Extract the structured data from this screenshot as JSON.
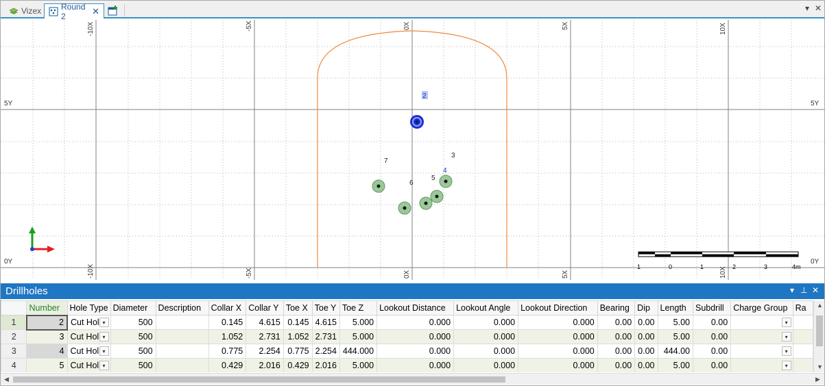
{
  "tabs": [
    {
      "label": "Vizex",
      "active": false
    },
    {
      "label": "Round 2",
      "active": true
    }
  ],
  "window_controls": {
    "dropdown": "▾",
    "close": "✕"
  },
  "viewport": {
    "x_labels": [
      "-10X",
      "-5X",
      "0X",
      "5X",
      "10X"
    ],
    "y_labels": [
      "5Y",
      "0Y"
    ],
    "hole_labels": [
      "2",
      "3",
      "4",
      "5",
      "6",
      "7"
    ],
    "scale_labels": [
      "1",
      "0",
      "1",
      "2",
      "3",
      "4m"
    ],
    "colors": {
      "profile": "#f08a3a",
      "selected_hole": "#1a2fd0",
      "hole_fill": "#9cc79a",
      "grid_major": "#777777",
      "grid_minor": "#aaaaaa"
    }
  },
  "panel": {
    "title": "Drillholes",
    "controls": {
      "dropdown": "▾",
      "pin": "⊥",
      "close": "✕"
    }
  },
  "table": {
    "columns": [
      "Number",
      "Hole Type",
      "Diameter",
      "Description",
      "Collar X",
      "Collar Y",
      "Toe X",
      "Toe Y",
      "Toe Z",
      "Lookout Distance",
      "Lookout Angle",
      "Lookout Direction",
      "Bearing",
      "Dip",
      "Length",
      "Subdrill",
      "Charge Group",
      "Ra"
    ],
    "rows": [
      {
        "row": "1",
        "cells": [
          "2",
          "Cut Hol",
          "500",
          "",
          "0.145",
          "4.615",
          "0.145",
          "4.615",
          "5.000",
          "0.000",
          "0.000",
          "0.000",
          "0.00",
          "0.00",
          "5.00",
          "0.00",
          "",
          ""
        ]
      },
      {
        "row": "2",
        "cells": [
          "3",
          "Cut Hol",
          "500",
          "",
          "1.052",
          "2.731",
          "1.052",
          "2.731",
          "5.000",
          "0.000",
          "0.000",
          "0.000",
          "0.00",
          "0.00",
          "5.00",
          "0.00",
          "",
          ""
        ]
      },
      {
        "row": "3",
        "cells": [
          "4",
          "Cut Hol",
          "500",
          "",
          "0.775",
          "2.254",
          "0.775",
          "2.254",
          "444.000",
          "0.000",
          "0.000",
          "0.000",
          "0.00",
          "0.00",
          "444.00",
          "0.00",
          "",
          ""
        ]
      },
      {
        "row": "4",
        "cells": [
          "5",
          "Cut Hol",
          "500",
          "",
          "0.429",
          "2.016",
          "0.429",
          "2.016",
          "5.000",
          "0.000",
          "0.000",
          "0.000",
          "0.00",
          "0.00",
          "5.00",
          "0.00",
          "",
          ""
        ]
      }
    ]
  }
}
